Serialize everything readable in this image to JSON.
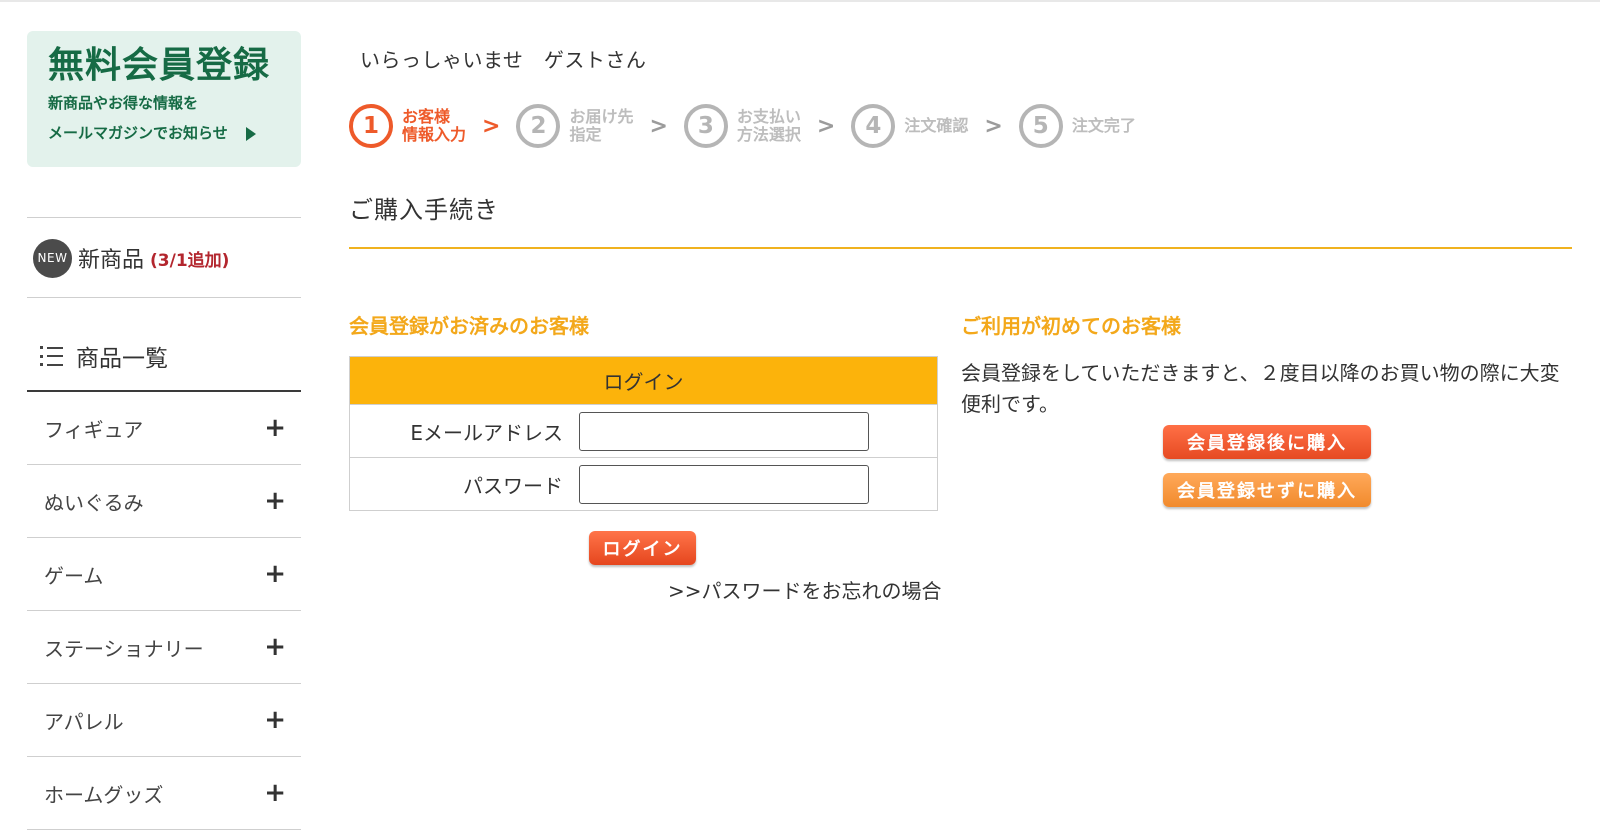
{
  "sidebar": {
    "promo": {
      "title": "無料会員登録",
      "line1": "新商品やお得な情報を",
      "line2": "メールマガジンでお知らせ"
    },
    "new_products": {
      "badge": "NEW",
      "label": "新商品",
      "note": "(3/1追加)"
    },
    "catalog": {
      "heading": "商品一覧",
      "items": [
        {
          "label": "フィギュア"
        },
        {
          "label": "ぬいぐるみ"
        },
        {
          "label": "ゲーム"
        },
        {
          "label": "ステーショナリー"
        },
        {
          "label": "アパレル"
        },
        {
          "label": "ホームグッズ"
        }
      ],
      "expand_symbol": "+"
    }
  },
  "header": {
    "greeting": "いらっしゃいませ　ゲストさん"
  },
  "steps": [
    {
      "number": "1",
      "label": "お客様\n情報入力",
      "active": true
    },
    {
      "number": "2",
      "label": "お届け先\n指定",
      "active": false
    },
    {
      "number": "3",
      "label": "お支払い\n方法選択",
      "active": false
    },
    {
      "number": "4",
      "label": "注文確認",
      "active": false
    },
    {
      "number": "5",
      "label": "注文完了",
      "active": false
    }
  ],
  "step_separator": ">",
  "page_title": "ご購入手続き",
  "member": {
    "heading": "会員登録がお済みのお客様",
    "table_header": "ログイン",
    "email_label": "Eメールアドレス",
    "email_value": "",
    "password_label": "パスワード",
    "password_value": "",
    "login_button": "ログイン",
    "forgot_link": ">>パスワードをお忘れの場合"
  },
  "first_time": {
    "heading": "ご利用が初めてのお客様",
    "description": "会員登録をしていただきますと、２度目以降のお買い物の際に大変便利です。",
    "register_button": "会員登録後に購入",
    "guest_button": "会員登録せずに購入"
  },
  "colors": {
    "brand_green": "#166b45",
    "promo_bg": "#e3f2ec",
    "accent_orange": "#f3a81b",
    "table_header": "#fcb30b",
    "active_step": "#ee5a2a",
    "new_note_red": "#b3262e"
  }
}
